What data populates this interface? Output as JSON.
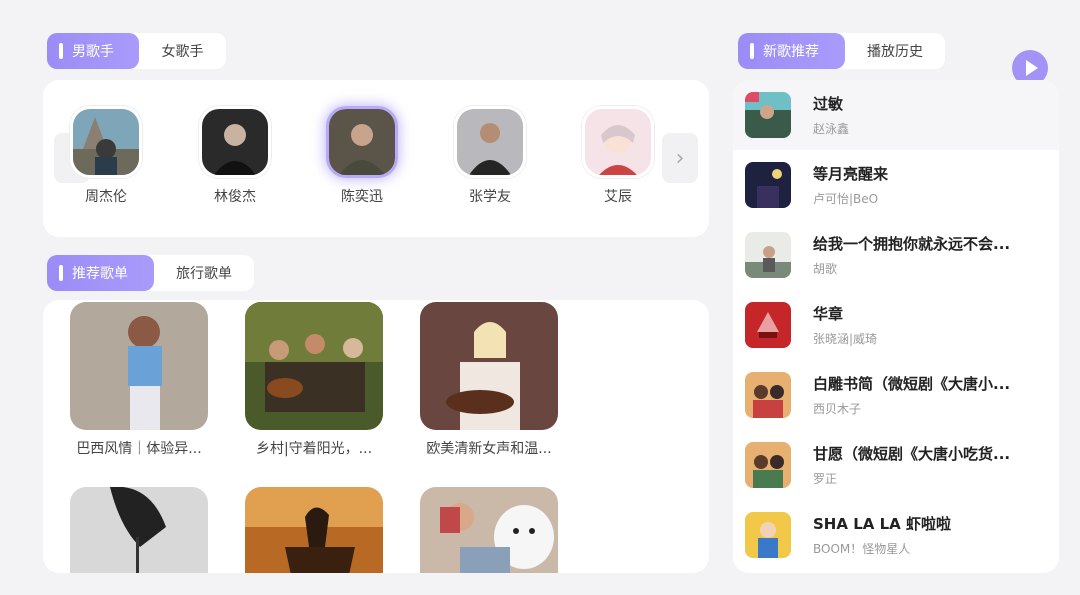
{
  "colors": {
    "accent": "#9b8cf6",
    "background": "#f3f3f5"
  },
  "singer_tabs": {
    "active": "男歌手",
    "inactive": "女歌手"
  },
  "singers": [
    {
      "name": "周杰伦"
    },
    {
      "name": "林俊杰"
    },
    {
      "name": "陈奕迅"
    },
    {
      "name": "张学友"
    },
    {
      "name": "艾辰"
    }
  ],
  "playlist_tabs": {
    "active": "推荐歌单",
    "inactive": "旅行歌单"
  },
  "playlists": [
    {
      "title": "巴西风情｜体验异..."
    },
    {
      "title": "乡村|守着阳光，..."
    },
    {
      "title": "欧美清新女声和温..."
    },
    {
      "title": ""
    },
    {
      "title": ""
    },
    {
      "title": ""
    }
  ],
  "song_tabs": {
    "active": "新歌推荐",
    "inactive": "播放历史"
  },
  "songs": [
    {
      "title": "过敏",
      "artist": "赵泳鑫"
    },
    {
      "title": "等月亮醒来",
      "artist": "卢可怡|BeO"
    },
    {
      "title": "给我一个拥抱你就永远不会...",
      "artist": "胡歌"
    },
    {
      "title": "华章",
      "artist": "张晓涵|威琦"
    },
    {
      "title": "白雕书简（微短剧《大唐小...",
      "artist": "西贝木子"
    },
    {
      "title": "甘愿（微短剧《大唐小吃货...",
      "artist": "罗正"
    },
    {
      "title": "SHA LA LA 虾啦啦",
      "artist": "BOOM！怪物星人"
    }
  ],
  "icons": {
    "prev": "chevron-left-icon",
    "next": "chevron-right-icon",
    "play": "play-icon"
  }
}
